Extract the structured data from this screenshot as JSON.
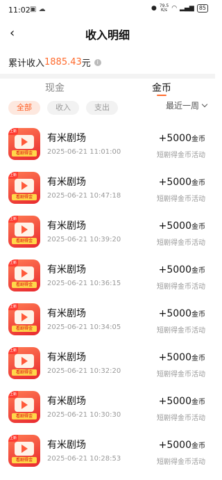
{
  "status": {
    "time": "11:02",
    "left_icons": "▣ ☁",
    "net_speed_value": "79.5",
    "net_speed_unit": "K/s",
    "battery": "85"
  },
  "header": {
    "title": "收入明细"
  },
  "summary": {
    "label": "累计收入",
    "amount": "1885.43",
    "unit": "元"
  },
  "tabs": [
    {
      "label": "现金"
    },
    {
      "label": "金币"
    }
  ],
  "filters": [
    {
      "label": "全部"
    },
    {
      "label": "收入"
    },
    {
      "label": "支出"
    }
  ],
  "period": {
    "label": "最近一周"
  },
  "records": [
    {
      "app": "有米剧场",
      "time": "2025-06-21 11:01:00",
      "amount": "+5000",
      "unit": "金币",
      "desc": "短剧得金币活动"
    },
    {
      "app": "有米剧场",
      "time": "2025-06-21 10:47:18",
      "amount": "+5000",
      "unit": "金币",
      "desc": "短剧得金币活动"
    },
    {
      "app": "有米剧场",
      "time": "2025-06-21 10:39:20",
      "amount": "+5000",
      "unit": "金币",
      "desc": "短剧得金币活动"
    },
    {
      "app": "有米剧场",
      "time": "2025-06-21 10:36:15",
      "amount": "+5000",
      "unit": "金币",
      "desc": "短剧得金币活动"
    },
    {
      "app": "有米剧场",
      "time": "2025-06-21 10:34:05",
      "amount": "+5000",
      "unit": "金币",
      "desc": "短剧得金币活动"
    },
    {
      "app": "有米剧场",
      "time": "2025-06-21 10:32:20",
      "amount": "+5000",
      "unit": "金币",
      "desc": "短剧得金币活动"
    },
    {
      "app": "有米剧场",
      "time": "2025-06-21 10:30:30",
      "amount": "+5000",
      "unit": "金币",
      "desc": "短剧得金币活动"
    },
    {
      "app": "有米剧场",
      "time": "2025-06-21 10:28:53",
      "amount": "+5000",
      "unit": "金币",
      "desc": "短剧得金币活动"
    }
  ],
  "icon_text": {
    "badge": "看剧得金",
    "corner": "上新"
  },
  "colors": {
    "accent": "#ff6a2c",
    "chip_active_bg": "#fde8df"
  }
}
